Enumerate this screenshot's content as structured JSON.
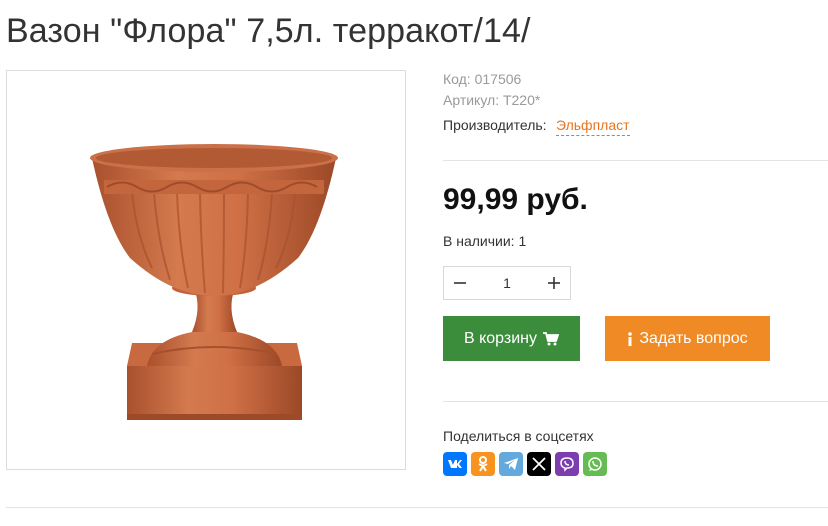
{
  "product": {
    "title": "Вазон \"Флора\" 7,5л. терракот/14/",
    "code": "Код: 017506",
    "article": "Артикул: Т220*",
    "manufacturer_label": "Производитель:",
    "manufacturer": "Эльфпласт",
    "price": "99,99 руб.",
    "stock": "В наличии: 1",
    "quantity": "1",
    "image_alt": "vase-terracotta",
    "colors": {
      "vase": "#c8683f",
      "cart_button": "#3b8d3b",
      "ask_button": "#f08a24",
      "link": "#e8741e"
    }
  },
  "actions": {
    "cart_label": "В корзину",
    "cart_icon": "cart-icon",
    "ask_label": "Задать вопрос",
    "ask_icon": "info-icon"
  },
  "share": {
    "label": "Поделиться в соцсетях",
    "networks": [
      {
        "name": "vk-icon",
        "color": "#0077ff"
      },
      {
        "name": "odnoklassniki-icon",
        "color": "#f7931e"
      },
      {
        "name": "telegram-icon",
        "color": "#64a9dc"
      },
      {
        "name": "x-icon",
        "color": "#000000"
      },
      {
        "name": "viber-icon",
        "color": "#7d3daf"
      },
      {
        "name": "whatsapp-icon",
        "color": "#65bc54"
      }
    ]
  }
}
